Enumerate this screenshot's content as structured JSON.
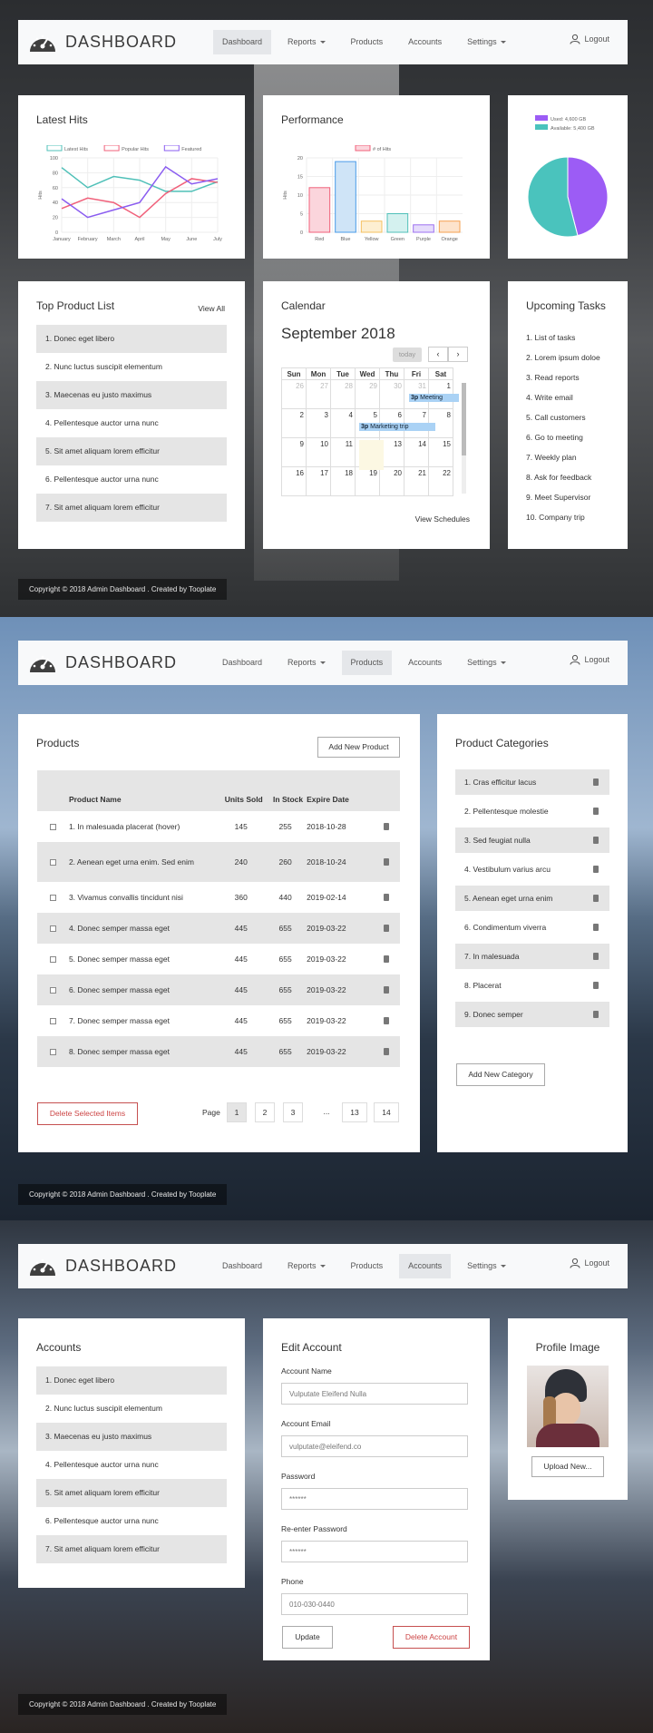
{
  "nav": {
    "brand": "DASHBOARD",
    "items": [
      "Dashboard",
      "Reports",
      "Products",
      "Accounts",
      "Settings"
    ],
    "logout": "Logout"
  },
  "footer": "Copyright © 2018 Admin Dashboard . Created by Tooplate",
  "dashboard": {
    "latest_hits": {
      "title": "Latest Hits",
      "chart_data": {
        "type": "line",
        "categories": [
          "January",
          "February",
          "March",
          "April",
          "May",
          "June",
          "July"
        ],
        "ylim": [
          0,
          100
        ],
        "yticks": [
          0,
          20,
          40,
          60,
          80,
          100
        ],
        "ylabel": "Hits",
        "series": [
          {
            "name": "Latest Hits",
            "color": "#4fc0b8",
            "values": [
              87,
              60,
              75,
              70,
              55,
              55,
              68
            ]
          },
          {
            "name": "Popular Hits",
            "color": "#f0607a",
            "values": [
              32,
              46,
              40,
              20,
              52,
              72,
              67
            ]
          },
          {
            "name": "Featured",
            "color": "#8a5cf0",
            "values": [
              45,
              20,
              30,
              40,
              88,
              65,
              72
            ]
          }
        ]
      }
    },
    "performance": {
      "title": "Performance",
      "chart_data": {
        "type": "bar",
        "categories": [
          "Red",
          "Blue",
          "Yellow",
          "Green",
          "Purple",
          "Orange"
        ],
        "values": [
          12,
          19,
          3,
          5,
          2,
          3
        ],
        "ylim": [
          0,
          20
        ],
        "yticks": [
          0,
          5,
          10,
          15,
          20
        ],
        "ylabel": "Hits",
        "series_name": "# of Hits",
        "fills": [
          "#fbd5dc",
          "#cfe4f7",
          "#fdefd2",
          "#d4f1ef",
          "#e6dcfb",
          "#fde3cc"
        ],
        "strokes": [
          "#f0607a",
          "#4a9be8",
          "#f5c060",
          "#4fc0b8",
          "#9c70f0",
          "#f5a050"
        ]
      }
    },
    "storage": {
      "chart_data": {
        "type": "pie",
        "labels": [
          "Used: 4,600 GB",
          "Available: 5,400 GB"
        ],
        "values": [
          4600,
          5400
        ],
        "colors": [
          "#9c5cf5",
          "#4ac3bd"
        ]
      }
    },
    "top_products": {
      "title": "Top Product List",
      "view_all": "View All",
      "items": [
        "1.  Donec eget libero",
        "2.  Nunc luctus suscipit elementum",
        "3.  Maecenas eu justo maximus",
        "4.  Pellentesque auctor urna nunc",
        "5.  Sit amet aliquam lorem efficitur",
        "6.  Pellentesque auctor urna nunc",
        "7.  Sit amet aliquam lorem efficitur"
      ]
    },
    "calendar": {
      "title": "Calendar",
      "month": "September 2018",
      "today": "today",
      "days": [
        "Sun",
        "Mon",
        "Tue",
        "Wed",
        "Thu",
        "Fri",
        "Sat"
      ],
      "rows": [
        [
          "26",
          "27",
          "28",
          "29",
          "30",
          "31",
          "1"
        ],
        [
          "2",
          "3",
          "4",
          "5",
          "6",
          "7",
          "8"
        ],
        [
          "9",
          "10",
          "11",
          "12",
          "13",
          "14",
          "15"
        ],
        [
          "16",
          "17",
          "18",
          "19",
          "20",
          "21",
          "22"
        ]
      ],
      "events": [
        {
          "time": "3p",
          "name": "Meeting"
        },
        {
          "time": "3p",
          "name": "Marketing trip"
        }
      ],
      "view_schedules": "View Schedules"
    },
    "tasks": {
      "title": "Upcoming Tasks",
      "items": [
        "1.  List of tasks",
        "2.  Lorem ipsum doloe",
        "3.  Read reports",
        "4.  Write email",
        "5.  Call customers",
        "6.  Go to meeting",
        "7.  Weekly plan",
        "8.  Ask for feedback",
        "9.  Meet Supervisor",
        "10.  Company trip"
      ]
    }
  },
  "products_page": {
    "title": "Products",
    "add_button": "Add New Product",
    "columns": [
      "Product Name",
      "Units Sold",
      "In Stock",
      "Expire Date"
    ],
    "rows": [
      [
        "1. In malesuada placerat (hover)",
        "145",
        "255",
        "2018-10-28"
      ],
      [
        "2. Aenean eget urna enim. Sed enim",
        "240",
        "260",
        "2018-10-24"
      ],
      [
        "3. Vivamus convallis tincidunt nisi",
        "360",
        "440",
        "2019-02-14"
      ],
      [
        "4. Donec semper massa eget",
        "445",
        "655",
        "2019-03-22"
      ],
      [
        "5. Donec semper massa eget",
        "445",
        "655",
        "2019-03-22"
      ],
      [
        "6. Donec semper massa eget",
        "445",
        "655",
        "2019-03-22"
      ],
      [
        "7. Donec semper massa eget",
        "445",
        "655",
        "2019-03-22"
      ],
      [
        "8. Donec semper massa eget",
        "445",
        "655",
        "2019-03-22"
      ]
    ],
    "delete_selected": "Delete Selected Items",
    "page_label": "Page",
    "pages": [
      "1",
      "2",
      "3",
      "...",
      "13",
      "14"
    ],
    "categories_title": "Product Categories",
    "categories": [
      "1. Cras efficitur lacus",
      "2. Pellentesque molestie",
      "3. Sed feugiat nulla",
      "4. Vestibulum varius arcu",
      "5. Aenean eget urna enim",
      "6. Condimentum viverra",
      "7. In malesuada",
      "8. Placerat",
      "9. Donec semper"
    ],
    "add_category": "Add New Category"
  },
  "accounts_page": {
    "title": "Accounts",
    "items": [
      "1.  Donec eget libero",
      "2.  Nunc luctus suscipit elementum",
      "3.  Maecenas eu justo maximus",
      "4.  Pellentesque auctor urna nunc",
      "5.  Sit amet aliquam lorem efficitur",
      "6.  Pellentesque auctor urna nunc",
      "7.  Sit amet aliquam lorem efficitur"
    ],
    "edit_title": "Edit Account",
    "fields": [
      {
        "label": "Account Name",
        "value": "Vulputate Eleifend Nulla"
      },
      {
        "label": "Account Email",
        "value": "vulputate@eleifend.co"
      },
      {
        "label": "Password",
        "value": "******"
      },
      {
        "label": "Re-enter Password",
        "value": "******"
      },
      {
        "label": "Phone",
        "value": "010-030-0440"
      }
    ],
    "update": "Update",
    "delete_account": "Delete Account",
    "profile_title": "Profile Image",
    "upload": "Upload New..."
  }
}
